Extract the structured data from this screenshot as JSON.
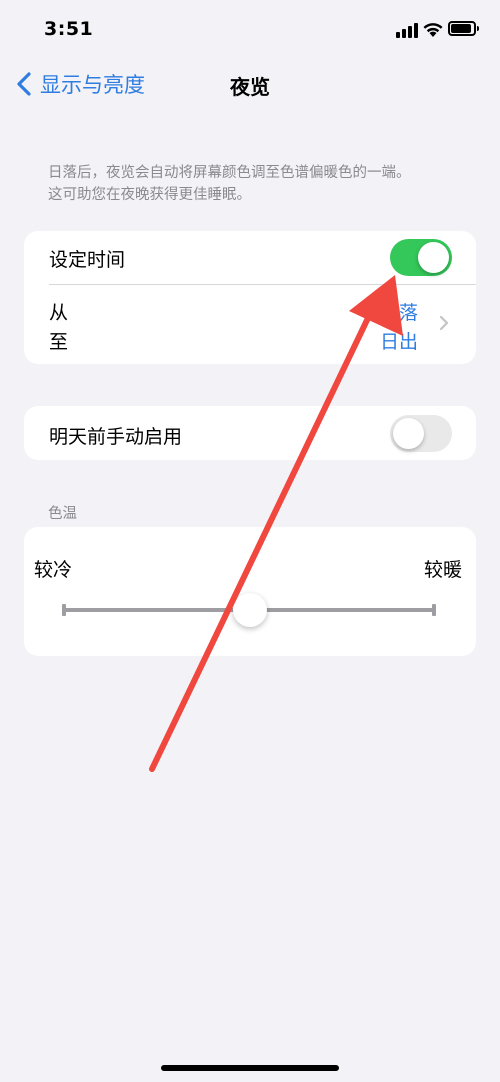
{
  "status_bar": {
    "time": "3:51"
  },
  "nav": {
    "back_label": "显示与亮度",
    "title": "夜览"
  },
  "description": {
    "line1": "日落后，夜览会自动将屏幕颜色调至色谱偏暖色的一端。",
    "line2": "这可助您在夜晚获得更佳睡眠。"
  },
  "schedule": {
    "label": "设定时间",
    "enabled": true,
    "from_label": "从",
    "to_label": "至",
    "from_value": "日落",
    "to_value": "日出"
  },
  "manual": {
    "label": "明天前手动启用",
    "enabled": false
  },
  "temperature": {
    "header": "色温",
    "cold_label": "较冷",
    "warm_label": "较暖",
    "level": 0.5
  },
  "colors": {
    "accent": "#2f7de1",
    "toggle_on": "#34c759",
    "annotation_arrow": "#f0473e"
  }
}
